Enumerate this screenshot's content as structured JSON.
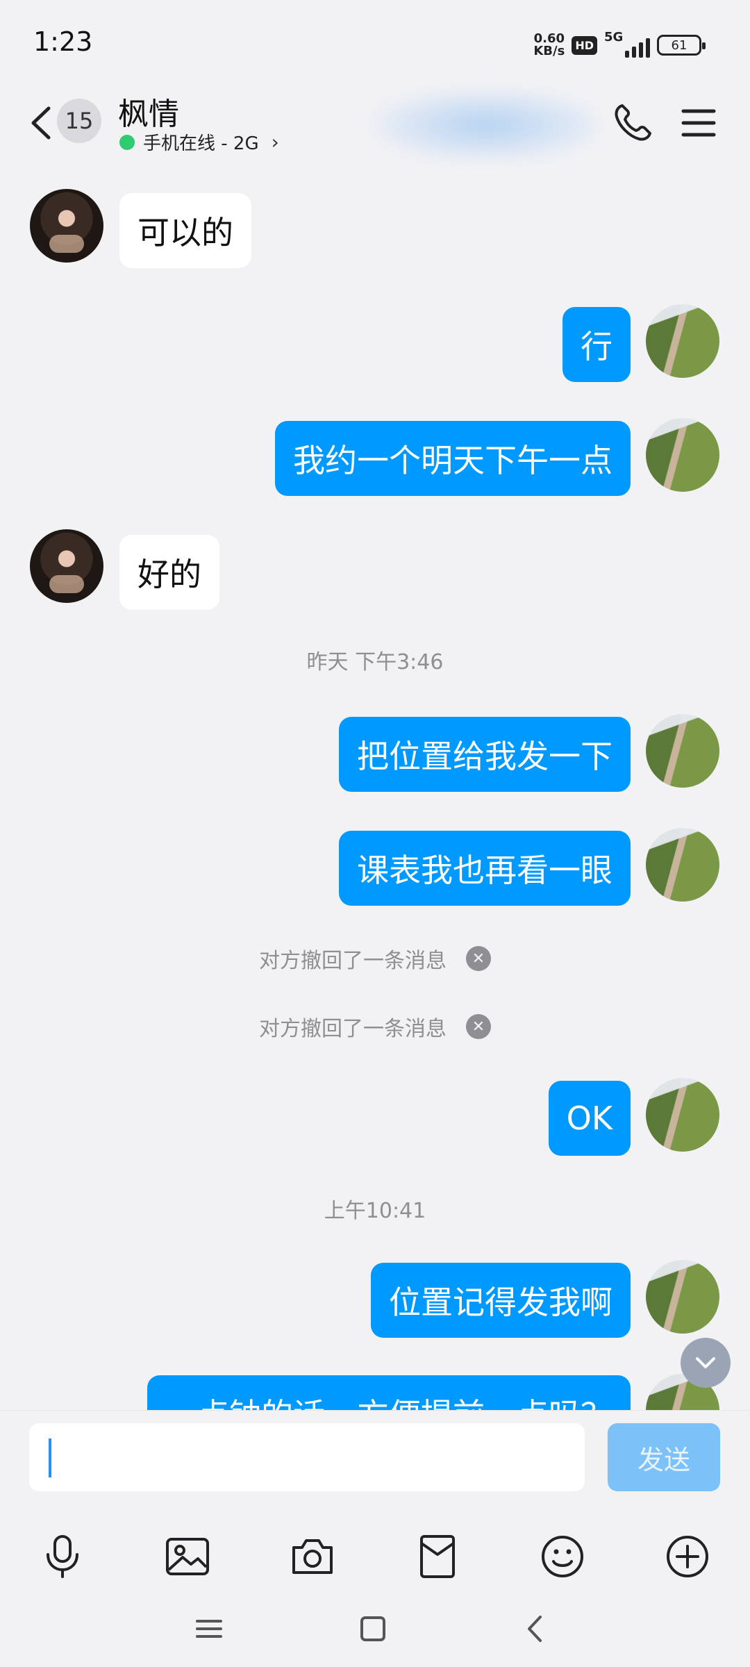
{
  "status_bar": {
    "time": "1:23",
    "net_speed_value": "0.60",
    "net_speed_unit": "KB/s",
    "hd_label": "HD",
    "network_label": "5G",
    "battery": "61"
  },
  "header": {
    "unread_count": "15",
    "contact_name": "枫情",
    "online_status": "手机在线 - 2G"
  },
  "messages": {
    "m1": "可以的",
    "m2": "行",
    "m3": "我约一个明天下午一点",
    "m4": "好的",
    "t1": "昨天 下午3:46",
    "m5": "把位置给我发一下",
    "m6": "课表我也再看一眼",
    "recall1": "对方撤回了一条消息",
    "recall2": "对方撤回了一条消息",
    "m7": "OK",
    "t2": "上午10:41",
    "m8": "位置记得发我啊",
    "m9": "一点钟的话，方便提前一点吗？"
  },
  "input": {
    "value": "",
    "send_label": "发送"
  },
  "colors": {
    "outgoing_bubble": "#0099ff",
    "incoming_bubble": "#ffffff",
    "send_button_disabled": "#7cc1f7",
    "online_dot": "#2ecc71"
  },
  "icons": {
    "back": "chevron-left-icon",
    "call": "phone-icon",
    "menu": "hamburger-menu-icon",
    "voice": "microphone-icon",
    "image": "image-icon",
    "camera": "camera-icon",
    "red_packet": "red-packet-icon",
    "emoji": "emoji-icon",
    "more": "plus-circle-icon"
  }
}
